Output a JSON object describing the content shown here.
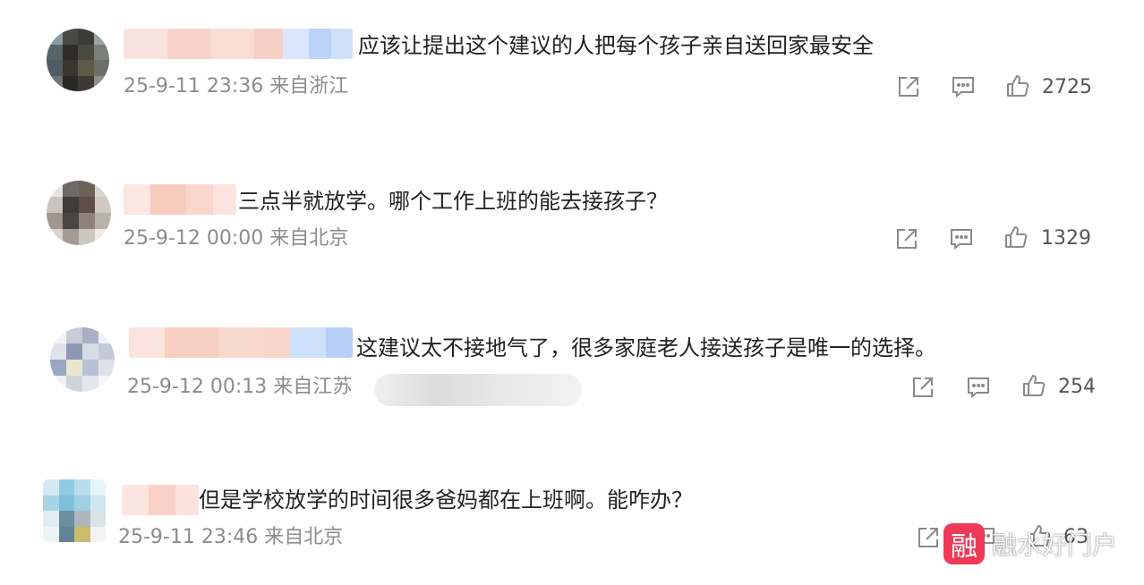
{
  "comments": [
    {
      "text": "应该让提出这个建议的人把每个孩子亲自送回家最安全",
      "meta": "25-9-11 23:36 来自浙江",
      "likes": "2725"
    },
    {
      "text": "三点半就放学。哪个工作上班的能去接孩子？",
      "meta": "25-9-12 00:00 来自北京",
      "likes": "1329"
    },
    {
      "text": "这建议太不接地气了，很多家庭老人接送孩子是唯一的选择。",
      "meta": "25-9-12 00:13 来自江苏",
      "likes": "254"
    },
    {
      "text": "但是学校放学的时间很多爸妈都在上班啊。能咋办？",
      "meta": "25-9-11 23:46 来自北京",
      "likes": "63"
    }
  ],
  "watermark": {
    "logo_char": "融",
    "text": "融水好门户"
  },
  "icons": {
    "share": "share-icon",
    "comment": "comment-icon",
    "like": "like-icon"
  },
  "colors": {
    "text": "#222222",
    "meta": "#8c8c8c",
    "watermark_logo": "#ee3a57"
  }
}
